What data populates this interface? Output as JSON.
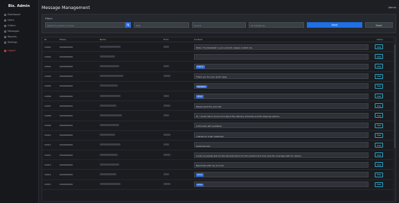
{
  "sidebar": {
    "brand": "Biz. Admin",
    "items": [
      {
        "label": "Dashboard"
      },
      {
        "label": "Users"
      },
      {
        "label": "Orders"
      },
      {
        "label": "Messages"
      },
      {
        "label": "Reports"
      },
      {
        "label": "Settings"
      }
    ],
    "logout": "Logout"
  },
  "header": {
    "title": "Message Management",
    "user": "Admin"
  },
  "filter": {
    "label": "Filters",
    "search_placeholder": "Search by phone or name",
    "field2": "Date",
    "field3": "Source",
    "field4": "All Categories",
    "apply": "Apply",
    "reset": "Reset"
  },
  "table": {
    "columns": [
      "ID",
      "Phone",
      "Name",
      "From",
      "Content",
      "Action"
    ],
    "rows": [
      {
        "id": "10001",
        "phone": "0000000000",
        "content": "Hello, I'm interested in your product, please contact me.",
        "badge": ""
      },
      {
        "id": "10002",
        "phone": "0000000000",
        "content": "",
        "badge": ""
      },
      {
        "id": "10003",
        "phone": "0000000000",
        "content": "",
        "badge": "Inquiry"
      },
      {
        "id": "10004",
        "phone": "0000000000",
        "content": "Thank you for your quick reply.",
        "badge": ""
      },
      {
        "id": "10005",
        "phone": "0000000000",
        "content": "",
        "badge": "Feedback"
      },
      {
        "id": "10006",
        "phone": "0000000000",
        "content": "",
        "badge": "Order"
      },
      {
        "id": "10007",
        "phone": "0000000000",
        "content": "Please send the price list.",
        "badge": ""
      },
      {
        "id": "10008",
        "phone": "0000000000",
        "content": "Hi, I would like to know more about the delivery schedule and the shipping options.",
        "badge": ""
      },
      {
        "id": "10009",
        "phone": "0000000000",
        "content": "Is this item still available?",
        "badge": ""
      },
      {
        "id": "10010",
        "phone": "0000000000",
        "content": "I placed an order yesterday.",
        "badge": ""
      },
      {
        "id": "10011",
        "phone": "0000000000",
        "content": "Great service!",
        "badge": ""
      },
      {
        "id": "10012",
        "phone": "0000000000",
        "content": "Could you please tell me the warranty terms for this product and how long the coverage lasts for repairs.",
        "badge": ""
      },
      {
        "id": "10013",
        "phone": "0000000000",
        "content": "Need help with my account.",
        "badge": ""
      },
      {
        "id": "10014",
        "phone": "0000000000",
        "content": "",
        "badge": "Order"
      },
      {
        "id": "10015",
        "phone": "0000000000",
        "content": "",
        "badge": "Order"
      }
    ],
    "view_label": "View"
  }
}
